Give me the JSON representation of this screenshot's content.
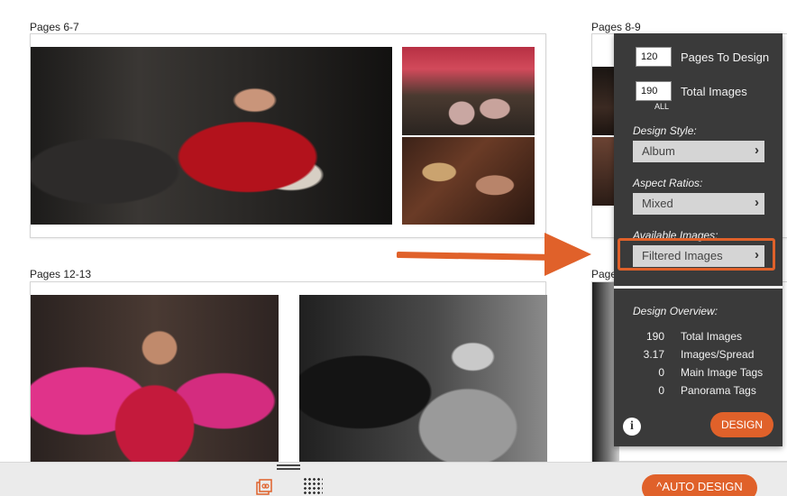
{
  "spreads": {
    "s67": {
      "label": "Pages 6-7"
    },
    "s89": {
      "label": "Pages 8-9"
    },
    "s1213": {
      "label": "Pages 12-13"
    },
    "s_right": {
      "label": "Page"
    }
  },
  "panel": {
    "pages_to_design": {
      "value": "120",
      "label": "Pages To Design"
    },
    "total_images": {
      "value": "190",
      "label": "Total Images",
      "sub": "ALL"
    },
    "design_style": {
      "label": "Design Style:",
      "value": "Album"
    },
    "aspect_ratios": {
      "label": "Aspect Ratios:",
      "value": "Mixed"
    },
    "available_images": {
      "label": "Available Images:",
      "value": "Filtered Images"
    },
    "overview": {
      "title": "Design Overview:",
      "stats": [
        {
          "value": "190",
          "label": "Total Images"
        },
        {
          "value": "3.17",
          "label": "Images/Spread"
        },
        {
          "value": "0",
          "label": "Main Image Tags"
        },
        {
          "value": "0",
          "label": "Panorama Tags"
        }
      ]
    },
    "info_icon": "i",
    "design_button": "DESIGN"
  },
  "bottom_bar": {
    "auto_design_button": "AUTO DESIGN",
    "icons": [
      "pages-icon",
      "grid-icon",
      "drag-handle-icon"
    ]
  },
  "colors": {
    "accent": "#e0612a",
    "panel_bg": "#3a3a3a",
    "bar_bg": "#ebebeb"
  }
}
